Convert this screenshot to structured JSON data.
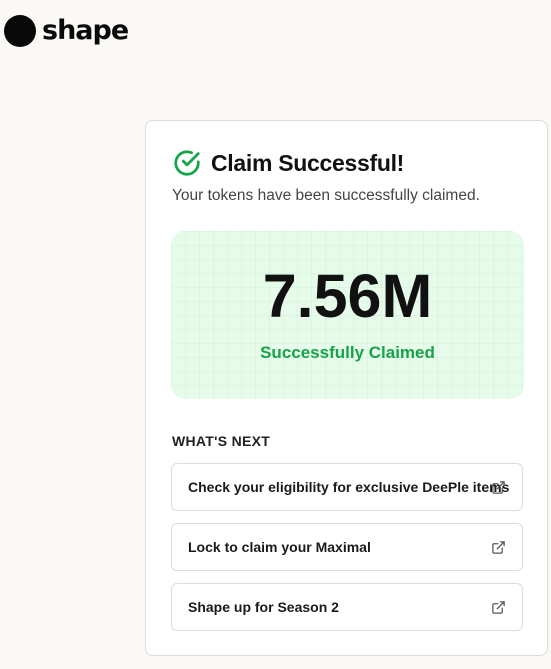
{
  "brand": {
    "logo_text": "shape"
  },
  "card": {
    "title": "Claim Successful!",
    "subtitle": "Your tokens have been successfully claimed.",
    "amount": "7.56M",
    "amount_status": "Successfully Claimed",
    "status_color": "#16a34a",
    "highlight_background": "#e7fbea"
  },
  "whats_next": {
    "heading": "WHAT'S NEXT",
    "items": [
      {
        "label": "Check your eligibility for exclusive DeePle items",
        "icon": "external-link-icon"
      },
      {
        "label": "Lock to claim your Maximal",
        "icon": "external-link-icon"
      },
      {
        "label": "Shape up for Season 2",
        "icon": "external-link-icon"
      }
    ]
  },
  "icons": {
    "title_icon": "check-circle-icon"
  }
}
